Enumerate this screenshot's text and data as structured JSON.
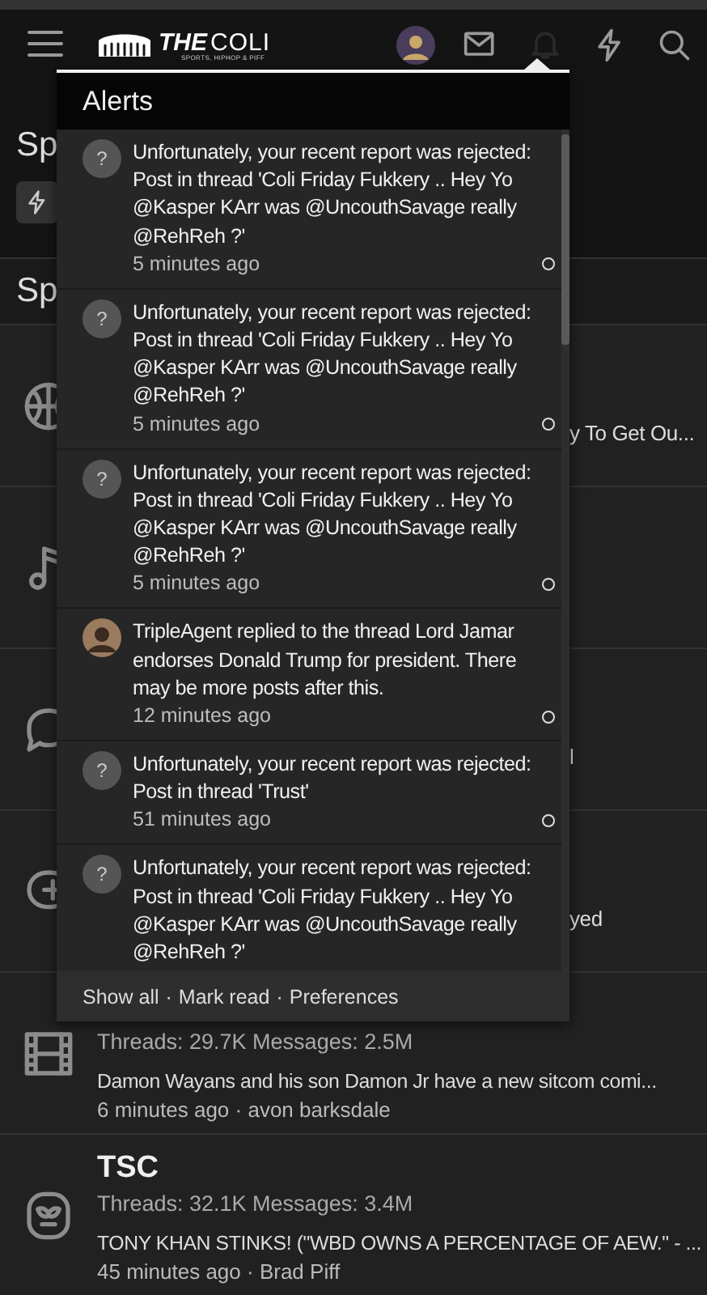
{
  "header": {
    "logo": {
      "title_bold": "THE",
      "title_light": "COLI",
      "tagline": "SPORTS, HIPHOP & PIFF"
    }
  },
  "page": {
    "title": "Sp",
    "section_title": "Sp",
    "forums": [
      {
        "kind": "basketball",
        "fragment": "y To Get Ou..."
      },
      {
        "kind": "music"
      },
      {
        "kind": "chat",
        "fragment": "l"
      },
      {
        "kind": "chat-plus",
        "fragment": "yed"
      },
      {
        "kind": "film",
        "stats": "Threads: 29.7K Messages: 2.5M",
        "latest": "Damon Wayans and his son Damon Jr have a new sitcom comi...",
        "meta": "6 minutes ago · avon barksdale"
      },
      {
        "kind": "mask",
        "title": "TSC",
        "stats": "Threads: 32.1K Messages: 3.4M",
        "latest": "TONY KHAN STINKS! (\"WBD OWNS A PERCENTAGE OF AEW.\" - ...",
        "meta": "45 minutes ago · Brad Piff"
      }
    ]
  },
  "alerts": {
    "title": "Alerts",
    "items": [
      {
        "avatar": {
          "kind": "placeholder",
          "glyph": "?"
        },
        "text": "Unfortunately, your recent report was rejected: Post in thread 'Coli Friday Fukkery .. Hey Yo @Kasper KArr was @UncouthSavage really @RehReh ?'",
        "time": "5 minutes ago",
        "read": false
      },
      {
        "avatar": {
          "kind": "placeholder",
          "glyph": "?"
        },
        "text": "Unfortunately, your recent report was rejected: Post in thread 'Coli Friday Fukkery .. Hey Yo @Kasper KArr was @UncouthSavage really @RehReh ?'",
        "time": "5 minutes ago",
        "read": false
      },
      {
        "avatar": {
          "kind": "placeholder",
          "glyph": "?"
        },
        "text": "Unfortunately, your recent report was rejected: Post in thread 'Coli Friday Fukkery .. Hey Yo @Kasper KArr was @UncouthSavage really @RehReh ?'",
        "time": "5 minutes ago",
        "read": false
      },
      {
        "avatar": {
          "kind": "user"
        },
        "text": "TripleAgent replied to the thread Lord Jamar endorses Donald Trump for president. There may be more posts after this.",
        "time": "12 minutes ago",
        "read": false
      },
      {
        "avatar": {
          "kind": "placeholder",
          "glyph": "?"
        },
        "text": "Unfortunately, your recent report was rejected: Post in thread 'Trust'",
        "time": "51 minutes ago",
        "read": false
      },
      {
        "avatar": {
          "kind": "placeholder",
          "glyph": "?"
        },
        "text": "Unfortunately, your recent report was rejected: Post in thread 'Coli Friday Fukkery .. Hey Yo @Kasper KArr was @UncouthSavage really @RehReh ?'"
      }
    ],
    "footer": {
      "links": [
        "Show all",
        "Mark read",
        "Preferences"
      ],
      "separator": "·"
    }
  }
}
